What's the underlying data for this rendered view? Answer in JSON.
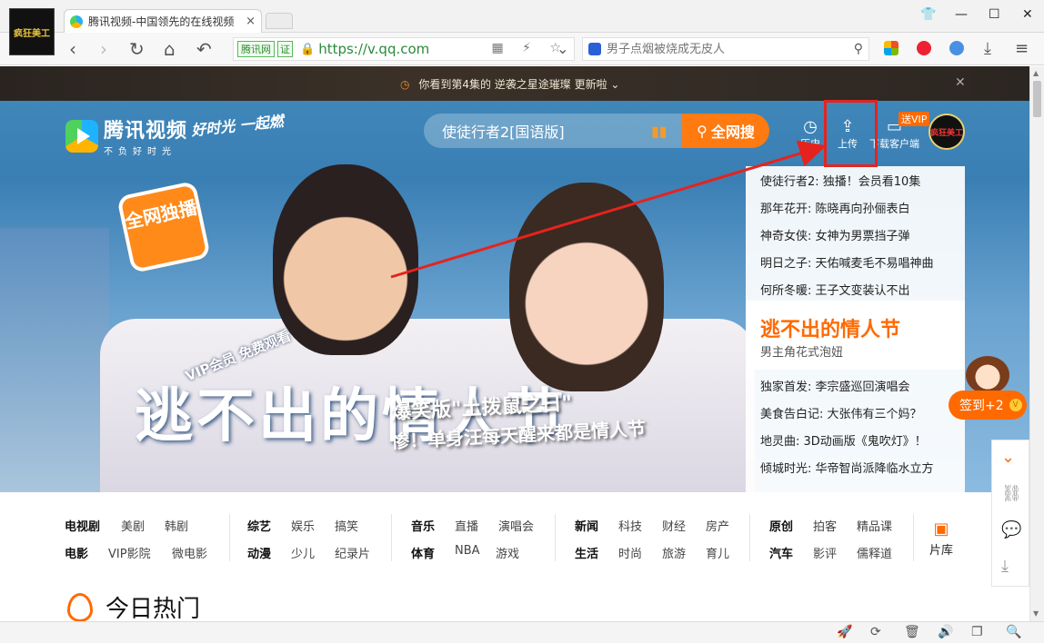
{
  "browser": {
    "app_logo_text": "疯狂美工",
    "tab": {
      "title": "腾讯视频-中国领先的在线视频",
      "close": "×"
    },
    "window_controls": {
      "skin": "👕",
      "minimize": "—",
      "maximize": "☐",
      "close": "✕"
    },
    "nav": {
      "back": "‹",
      "forward": "›",
      "reload": "↻",
      "home": "⌂",
      "undo": "↶"
    },
    "address": {
      "site_badge": "腾讯网",
      "cert_badge": "证",
      "url": "https://v.qq.com",
      "tools": "▦ ⚡ ☆"
    },
    "search": {
      "placeholder": "男子点烟被烧成无皮人",
      "dropdown": "⌄"
    },
    "right_tools": {
      "download": "⤓",
      "menu": "≡"
    },
    "accent": "#2a8a3a"
  },
  "notice": {
    "text": "你看到第4集的 逆袭之星途璀璨 更新啦",
    "chevron": "⌄",
    "close": "✕"
  },
  "header": {
    "logo_big": "腾讯视频",
    "logo_small": "不负好时光",
    "slogan": "好时光 一起燃",
    "search_value": "使徒行者2[国语版]",
    "search_button": "全网搜",
    "history_label": "历史",
    "upload_label": "上传",
    "client_label": "下载客户端",
    "vip_tag": "送VIP",
    "avatar_text": "疯狂美工",
    "accent": "#ff7a11"
  },
  "hero": {
    "badge": "全网独播",
    "vip_stamp": "VIP会员 免费观看",
    "movie_title": "逃不出的情人节",
    "caption1": "爆笑版\"土拨鼠之日\"",
    "caption2": "惨！单身汪每天醒来都是情人节"
  },
  "side_list": {
    "items_top": [
      "使徒行者2: 独播！会员看10集",
      "那年花开: 陈晓再向孙俪表白",
      "神奇女侠: 女神为男票挡子弹",
      "明日之子: 天佑喊麦毛不易唱神曲",
      "何所冬暖: 王子文变装认不出"
    ],
    "feature_title": "逃不出的情人节",
    "feature_sub": "男主角花式泡妞",
    "items_bottom": [
      "独家首发: 李宗盛巡回演唱会",
      "美食告白记: 大张伟有三个妈？",
      "地灵曲: 3D动画版《鬼吹灯》！",
      "倾城时光: 华帝智尚派降临水立方"
    ]
  },
  "signin": {
    "label": "签到+2",
    "coin": "V"
  },
  "side_tools": [
    "⌄",
    "⛓",
    "💬",
    "⤓"
  ],
  "nav": {
    "groups": [
      {
        "row1": [
          "电视剧",
          "美剧",
          "韩剧"
        ],
        "row2": [
          "电影",
          "VIP影院",
          "微电影"
        ]
      },
      {
        "row1": [
          "综艺",
          "娱乐",
          "搞笑"
        ],
        "row2": [
          "动漫",
          "少儿",
          "纪录片"
        ]
      },
      {
        "row1": [
          "音乐",
          "直播",
          "演唱会"
        ],
        "row2": [
          "体育",
          "NBA",
          "游戏"
        ]
      },
      {
        "row1": [
          "新闻",
          "科技",
          "财经",
          "房产"
        ],
        "row2": [
          "生活",
          "时尚",
          "旅游",
          "育儿"
        ]
      },
      {
        "row1": [
          "原创",
          "拍客",
          "精品课"
        ],
        "row2": [
          "汽车",
          "影评",
          "儒释道"
        ]
      }
    ],
    "library": "片库"
  },
  "section": {
    "title": "今日热门"
  },
  "statusbar": [
    "🚀",
    "⟳",
    "🗑",
    "🔊",
    "❐",
    "🔍"
  ]
}
